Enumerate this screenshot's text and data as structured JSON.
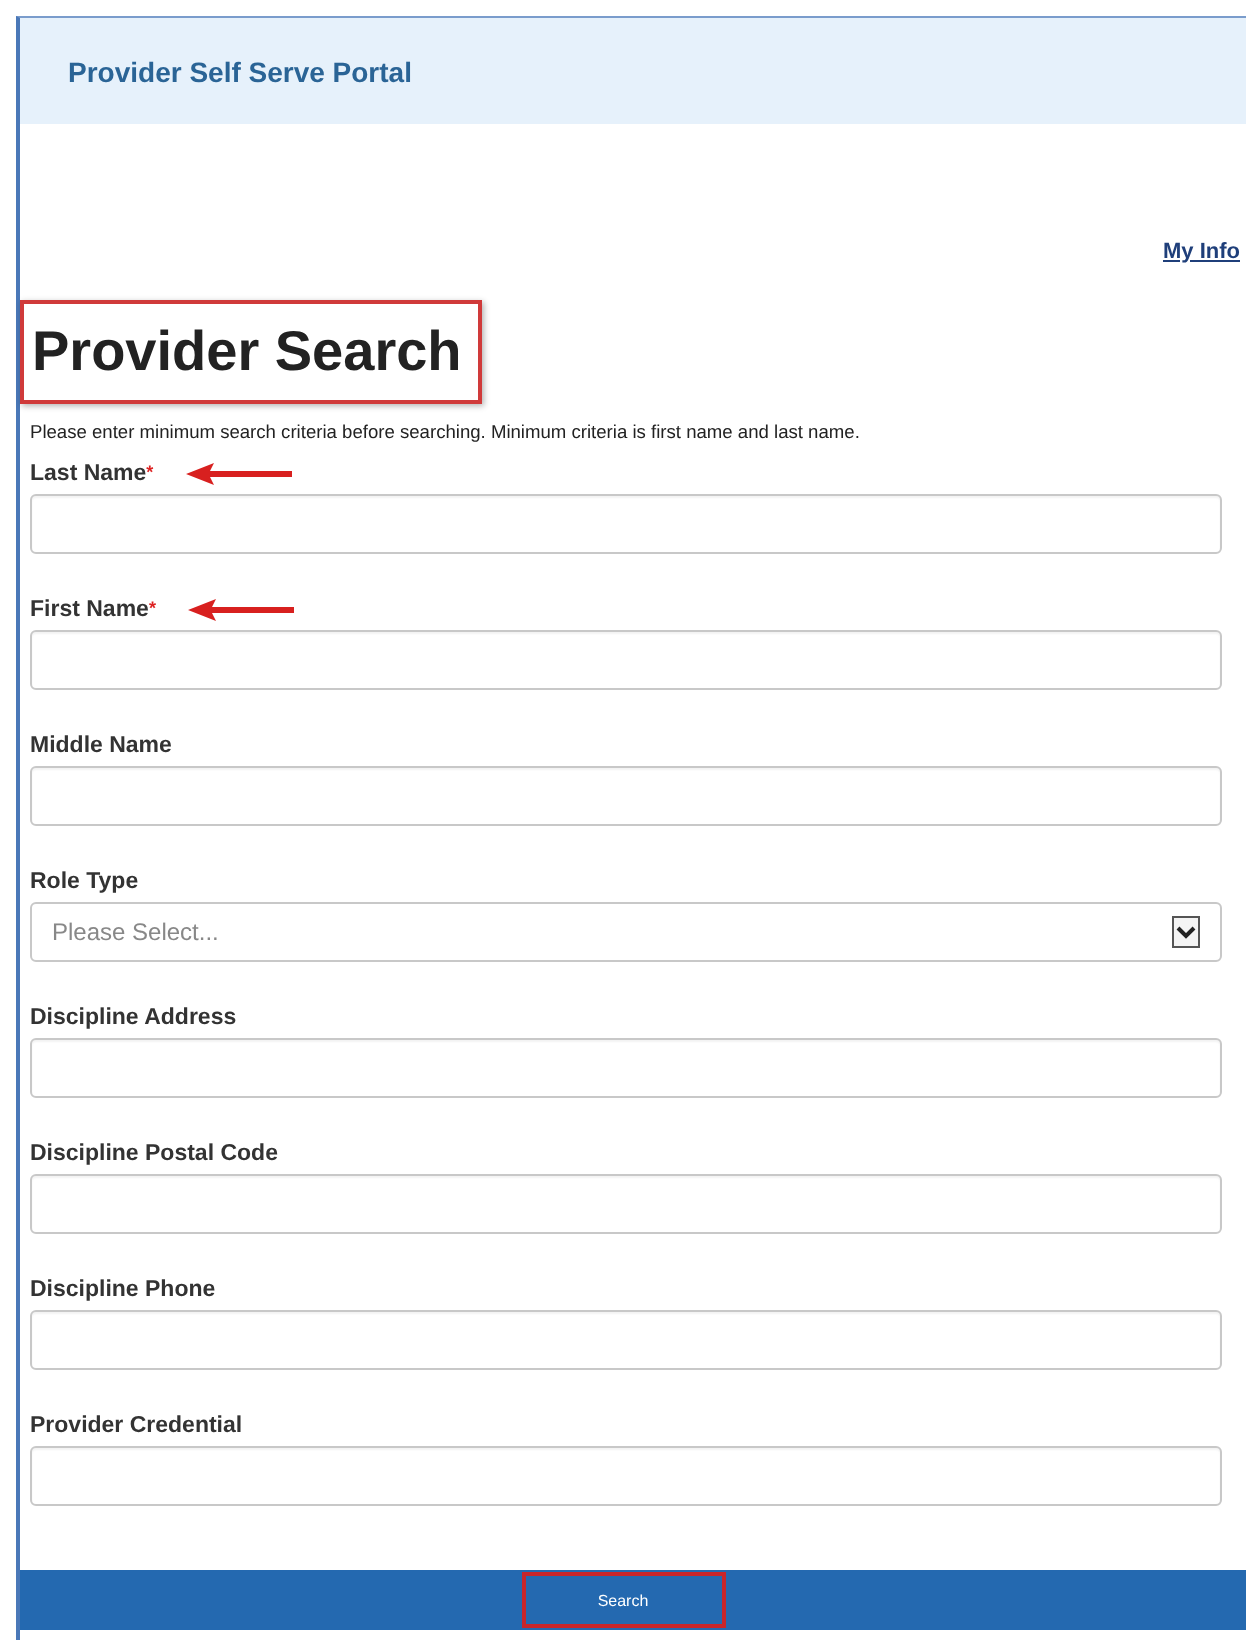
{
  "header": {
    "title": "Provider Self Serve Portal"
  },
  "nav_link": "My Info",
  "page_title": {
    "text": "Provider Search",
    "highlighted": true
  },
  "instructions": "Please enter minimum search criteria before searching. Minimum criteria is first name and last name.",
  "fields": [
    {
      "kind": "text",
      "label": "Last Name",
      "required_mark": "*",
      "annotated": true
    },
    {
      "kind": "text",
      "label": "First Name",
      "required_mark": "*",
      "annotated": true
    },
    {
      "kind": "text",
      "label": "Middle Name",
      "annotated": false
    },
    {
      "kind": "select",
      "label": "Role Type",
      "placeholder": "Please Select...",
      "annotated": false
    },
    {
      "kind": "text",
      "label": "Discipline Address",
      "annotated": false
    },
    {
      "kind": "text",
      "label": "Discipline Postal Code",
      "annotated": false
    },
    {
      "kind": "text",
      "label": "Discipline Phone",
      "annotated": false
    },
    {
      "kind": "text",
      "label": "Provider Credential",
      "annotated": false
    }
  ],
  "footer": {
    "button": "Search",
    "highlighted": true
  }
}
